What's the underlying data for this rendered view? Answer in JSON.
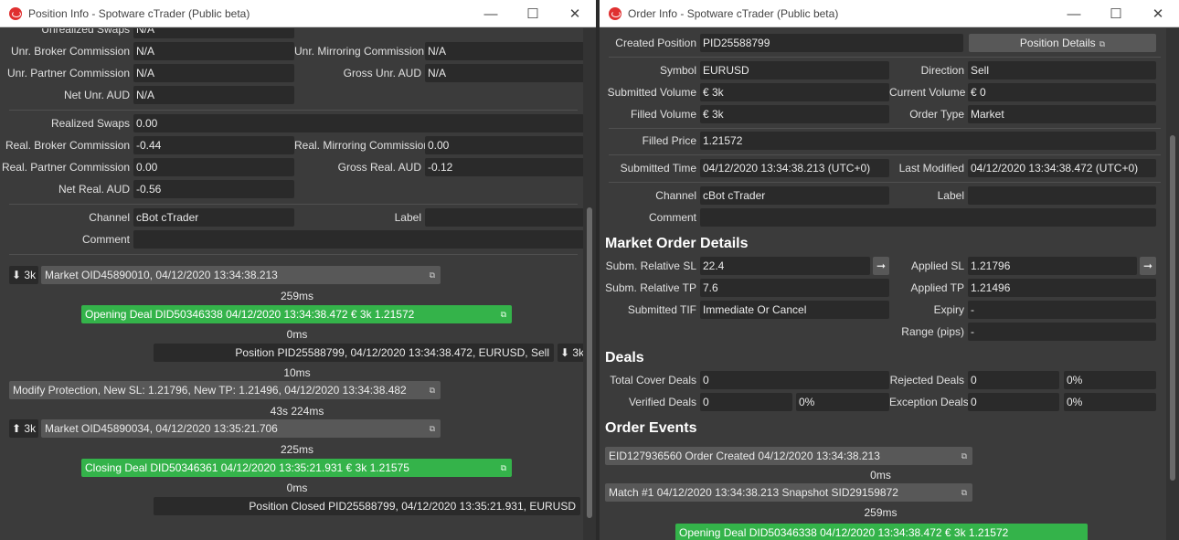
{
  "left": {
    "title": "Position Info - Spotware cTrader (Public beta)",
    "controls": {
      "minimize": "—",
      "maximize": "☐",
      "close": "✕"
    },
    "fields": {
      "unrealized_swaps": {
        "label": "Unrealized Swaps",
        "value": "N/A"
      },
      "unr_broker_commission": {
        "label": "Unr. Broker Commission",
        "value": "N/A"
      },
      "unr_mirroring_commission": {
        "label": "Unr. Mirroring Commission",
        "value": "N/A"
      },
      "unr_partner_commission": {
        "label": "Unr. Partner Commission",
        "value": "N/A"
      },
      "gross_unr": {
        "label": "Gross Unr. AUD",
        "value": "N/A"
      },
      "net_unr": {
        "label": "Net Unr. AUD",
        "value": "N/A"
      },
      "realized_swaps": {
        "label": "Realized Swaps",
        "value": "0.00"
      },
      "real_broker_commission": {
        "label": "Real. Broker Commission",
        "value": "-0.44"
      },
      "real_mirroring_commission": {
        "label": "Real. Mirroring Commission",
        "value": "0.00"
      },
      "real_partner_commission": {
        "label": "Real. Partner Commission",
        "value": "0.00"
      },
      "gross_real": {
        "label": "Gross Real. AUD",
        "value": "-0.12"
      },
      "net_real": {
        "label": "Net Real. AUD",
        "value": "-0.56"
      },
      "channel": {
        "label": "Channel",
        "value": "cBot cTrader"
      },
      "label": {
        "label": "Label",
        "value": ""
      },
      "comment": {
        "label": "Comment",
        "value": ""
      }
    },
    "events": {
      "ev1_vol": "⬇ 3k",
      "ev1": "Market OID45890010, 04/12/2020 13:34:38.213",
      "d1": "259ms",
      "ev2": "Opening Deal DID50346338 04/12/2020 13:34:38.472 € 3k 1.21572",
      "d2": "0ms",
      "ev3": "Position PID25588799, 04/12/2020 13:34:38.472, EURUSD, Sell",
      "ev3_vol": "⬇ 3k",
      "d3": "10ms",
      "ev4": "Modify Protection, New SL: 1.21796, New TP: 1.21496, 04/12/2020 13:34:38.482",
      "d4": "43s 224ms",
      "ev5_vol": "⬆ 3k",
      "ev5": "Market OID45890034, 04/12/2020 13:35:21.706",
      "d5": "225ms",
      "ev6": "Closing Deal DID50346361 04/12/2020 13:35:21.931 € 3k 1.21575",
      "d6": "0ms",
      "ev7": "Position Closed PID25588799, 04/12/2020 13:35:21.931, EURUSD"
    }
  },
  "right": {
    "title": "Order Info - Spotware cTrader (Public beta)",
    "controls": {
      "minimize": "—",
      "maximize": "☐",
      "close": "✕"
    },
    "fields": {
      "created_position": {
        "label": "Created Position",
        "value": "PID25588799"
      },
      "position_details_button": "Position Details",
      "symbol": {
        "label": "Symbol",
        "value": "EURUSD"
      },
      "direction": {
        "label": "Direction",
        "value": "Sell"
      },
      "submitted_volume": {
        "label": "Submitted Volume",
        "value": "€ 3k"
      },
      "current_volume": {
        "label": "Current Volume",
        "value": "€ 0"
      },
      "filled_volume": {
        "label": "Filled Volume",
        "value": "€ 3k"
      },
      "order_type": {
        "label": "Order Type",
        "value": "Market"
      },
      "filled_price": {
        "label": "Filled Price",
        "value": " 1.21572"
      },
      "submitted_time": {
        "label": "Submitted Time",
        "value": "04/12/2020 13:34:38.213 (UTC+0)"
      },
      "last_modified": {
        "label": "Last Modified",
        "value": "04/12/2020 13:34:38.472 (UTC+0)"
      },
      "channel": {
        "label": "Channel",
        "value": "cBot cTrader"
      },
      "label": {
        "label": "Label",
        "value": ""
      },
      "comment": {
        "label": "Comment",
        "value": ""
      }
    },
    "market_order": {
      "title": "Market Order Details",
      "subm_rel_sl": {
        "label": "Subm. Relative SL",
        "value": "22.4"
      },
      "applied_sl": {
        "label": "Applied SL",
        "value": "1.21796"
      },
      "subm_rel_tp": {
        "label": "Subm. Relative TP",
        "value": "7.6"
      },
      "applied_tp": {
        "label": "Applied TP",
        "value": "1.21496"
      },
      "submitted_tif": {
        "label": "Submitted TIF",
        "value": "Immediate Or Cancel"
      },
      "expiry": {
        "label": "Expiry",
        "value": "-"
      },
      "range": {
        "label": "Range (pips)",
        "value": "-"
      },
      "arrow": "➞"
    },
    "deals": {
      "title": "Deals",
      "total_cover": {
        "label": "Total Cover Deals",
        "value": "0"
      },
      "rejected": {
        "label": "Rejected Deals",
        "value": "0",
        "pct": "0%"
      },
      "verified": {
        "label": "Verified Deals",
        "value": "0",
        "pct": "0%"
      },
      "exception": {
        "label": "Exception Deals",
        "value": "0",
        "pct": "0%"
      }
    },
    "order_events": {
      "title": "Order Events",
      "ev1": "EID127936560 Order Created 04/12/2020 13:34:38.213",
      "d1": "0ms",
      "ev2": "Match #1 04/12/2020 13:34:38.213 Snapshot SID29159872",
      "d2": "259ms",
      "ev3": "Opening Deal DID50346338 04/12/2020 13:34:38.472 € 3k 1.21572"
    }
  },
  "icons": {
    "external": "⧉"
  }
}
